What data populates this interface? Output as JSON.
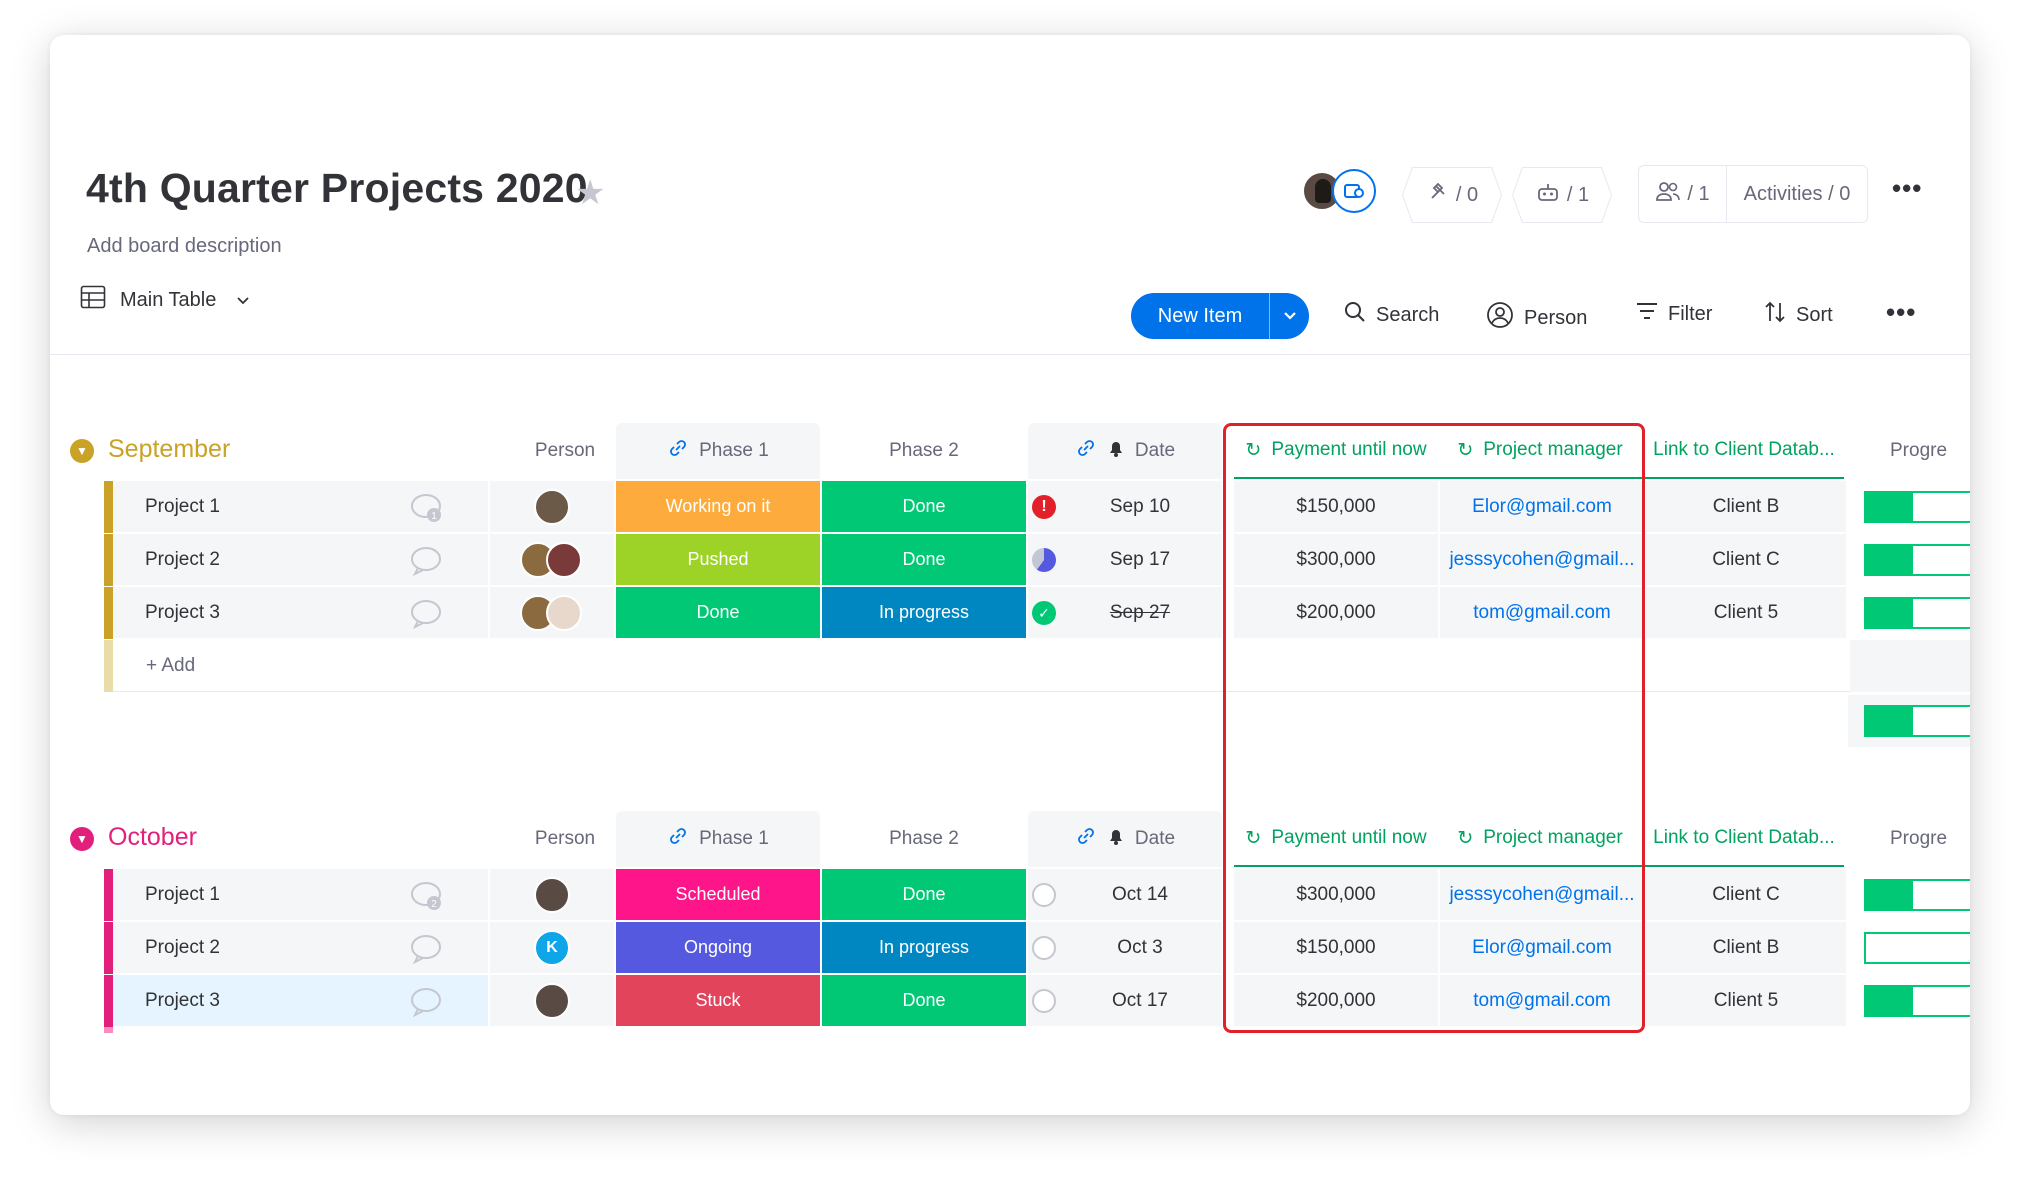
{
  "board": {
    "title": "4th Quarter Projects 2020",
    "description": "Add board description",
    "integrations_count": "/ 0",
    "automations_count": "/ 1",
    "members_count": "/ 1",
    "activities": "Activities / 0"
  },
  "toolbar": {
    "view_label": "Main Table",
    "new_item": "New Item",
    "search": "Search",
    "person": "Person",
    "filter": "Filter",
    "sort": "Sort"
  },
  "columns": {
    "person": "Person",
    "phase1": "Phase 1",
    "phase2": "Phase 2",
    "date": "Date",
    "payment": "Payment until now",
    "manager": "Project manager",
    "client_link": "Link to Client Datab...",
    "progress": "Progre"
  },
  "colors": {
    "september": "#c9a227",
    "october": "#e2207c",
    "accent": "#0073ea",
    "done": "#00c875",
    "working": "#fdab3d",
    "pushed": "#9cd326",
    "in_progress": "#0086c0",
    "scheduled": "#ff158a",
    "ongoing": "#5559df",
    "stuck": "#e2445c",
    "highlight": "#e2202a"
  },
  "groups": [
    {
      "title": "September",
      "add_label": "+ Add",
      "rows": [
        {
          "name": "Project 1",
          "phase1": "Working on it",
          "phase2": "Done",
          "date": "Sep 10",
          "payment": "$150,000",
          "manager": "Elor@gmail.com",
          "client": "Client B",
          "progress": 0.45
        },
        {
          "name": "Project 2",
          "phase1": "Pushed",
          "phase2": "Done",
          "date": "Sep 17",
          "payment": "$300,000",
          "manager": "jesssycohen@gmail...",
          "client": "Client C",
          "progress": 0.45
        },
        {
          "name": "Project 3",
          "phase1": "Done",
          "phase2": "In progress",
          "date": "Sep 27",
          "payment": "$200,000",
          "manager": "tom@gmail.com",
          "client": "Client 5",
          "progress": 0.45
        }
      ],
      "summary_progress": 0.45
    },
    {
      "title": "October",
      "rows": [
        {
          "name": "Project 1",
          "phase1": "Scheduled",
          "phase2": "Done",
          "date": "Oct 14",
          "payment": "$300,000",
          "manager": "jesssycohen@gmail...",
          "client": "Client C",
          "progress": 0.45
        },
        {
          "name": "Project 2",
          "phase1": "Ongoing",
          "phase2": "In progress",
          "date": "Oct 3",
          "payment": "$150,000",
          "manager": "Elor@gmail.com",
          "client": "Client B",
          "progress": 0
        },
        {
          "name": "Project 3",
          "phase1": "Stuck",
          "phase2": "Done",
          "date": "Oct 17",
          "payment": "$200,000",
          "manager": "tom@gmail.com",
          "client": "Client 5",
          "progress": 0.45
        }
      ]
    }
  ],
  "update_counts": {
    "sep_project1": "1",
    "oct_project1": "2"
  },
  "oct_project2_avatar_initial": "K"
}
